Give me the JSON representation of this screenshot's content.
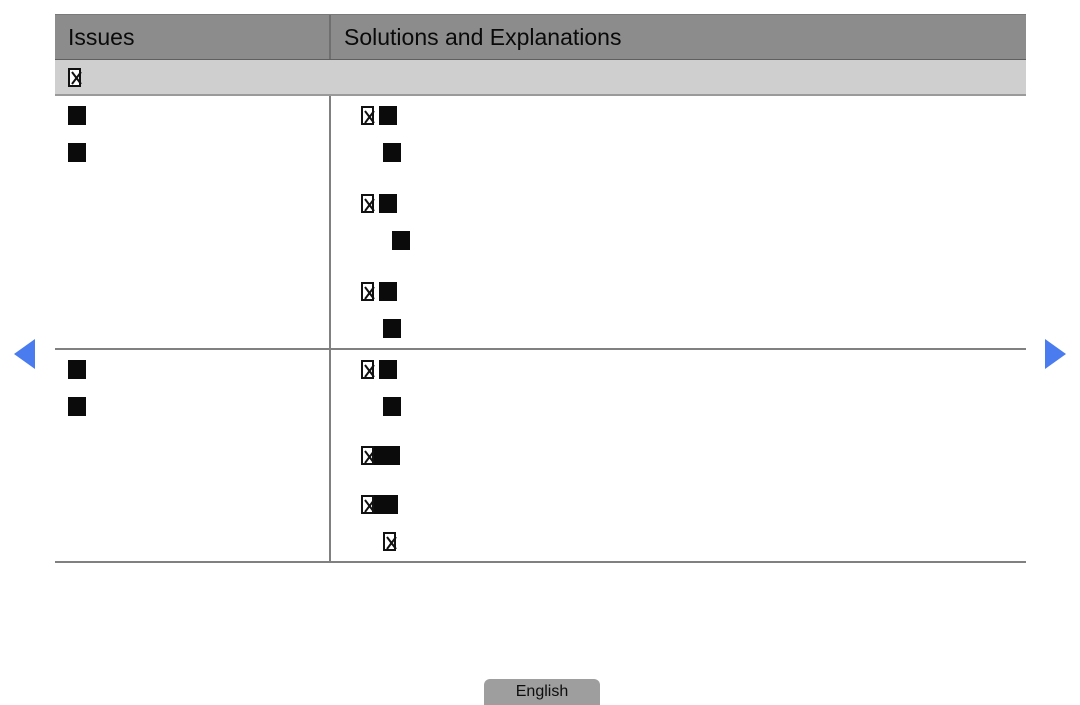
{
  "page": {
    "background": "#ffffff",
    "accent_color": "#4a7cf0",
    "header_bg": "#8c8c8c",
    "subheader_bg": "#cfcfcf",
    "border_color": "#808080"
  },
  "table": {
    "columns": [
      {
        "key": "issues",
        "label": "Issues"
      },
      {
        "key": "solutions",
        "label": "Solutions and Explanations"
      }
    ],
    "subheader": {
      "issues_glyphs": [
        {
          "type": "tofu"
        }
      ],
      "solutions_glyphs": []
    },
    "rows": [
      {
        "issues_lines": [
          {
            "indent": 0,
            "glyphs": [
              {
                "type": "block",
                "size": "md"
              }
            ]
          },
          {
            "indent": 0,
            "glyphs": [
              {
                "type": "block",
                "size": "md"
              }
            ]
          }
        ],
        "solutions_lines": [
          {
            "indent": 0,
            "glyphs": [
              {
                "type": "tofu"
              },
              {
                "type": "block",
                "size": "md"
              }
            ]
          },
          {
            "indent": 1,
            "glyphs": [
              {
                "type": "block",
                "size": "md"
              }
            ]
          },
          {
            "indent": 0,
            "glyphs": [
              {
                "type": "tofu"
              },
              {
                "type": "block",
                "size": "md"
              }
            ]
          },
          {
            "indent": 1,
            "glyphs": [
              {
                "type": "block",
                "size": "md",
                "sliver": true
              }
            ]
          },
          {
            "indent": 0,
            "glyphs": [
              {
                "type": "tofu"
              },
              {
                "type": "block",
                "size": "md"
              }
            ]
          },
          {
            "indent": 1,
            "glyphs": [
              {
                "type": "block",
                "size": "md"
              }
            ]
          }
        ]
      },
      {
        "issues_lines": [
          {
            "indent": 0,
            "glyphs": [
              {
                "type": "block",
                "size": "md"
              }
            ]
          },
          {
            "indent": 0,
            "glyphs": [
              {
                "type": "block",
                "size": "md"
              }
            ]
          }
        ],
        "solutions_lines": [
          {
            "indent": 0,
            "glyphs": [
              {
                "type": "tofu"
              },
              {
                "type": "block",
                "size": "md"
              }
            ]
          },
          {
            "indent": 1,
            "glyphs": [
              {
                "type": "block",
                "size": "md"
              }
            ]
          },
          {
            "indent": 0,
            "glyphs": [
              {
                "type": "tofu"
              },
              {
                "type": "block",
                "size": "xl"
              }
            ]
          },
          {
            "indent": 0,
            "glyphs": [
              {
                "type": "tofu"
              },
              {
                "type": "block",
                "size": "lg"
              }
            ]
          },
          {
            "indent": 1,
            "glyphs": [
              {
                "type": "tofu"
              }
            ]
          }
        ]
      }
    ]
  },
  "navigation": {
    "previous": {
      "icon": "triangle-left-icon",
      "label": "Previous"
    },
    "next": {
      "icon": "triangle-right-icon",
      "label": "Next"
    }
  },
  "footer": {
    "language_button_label": "English"
  }
}
